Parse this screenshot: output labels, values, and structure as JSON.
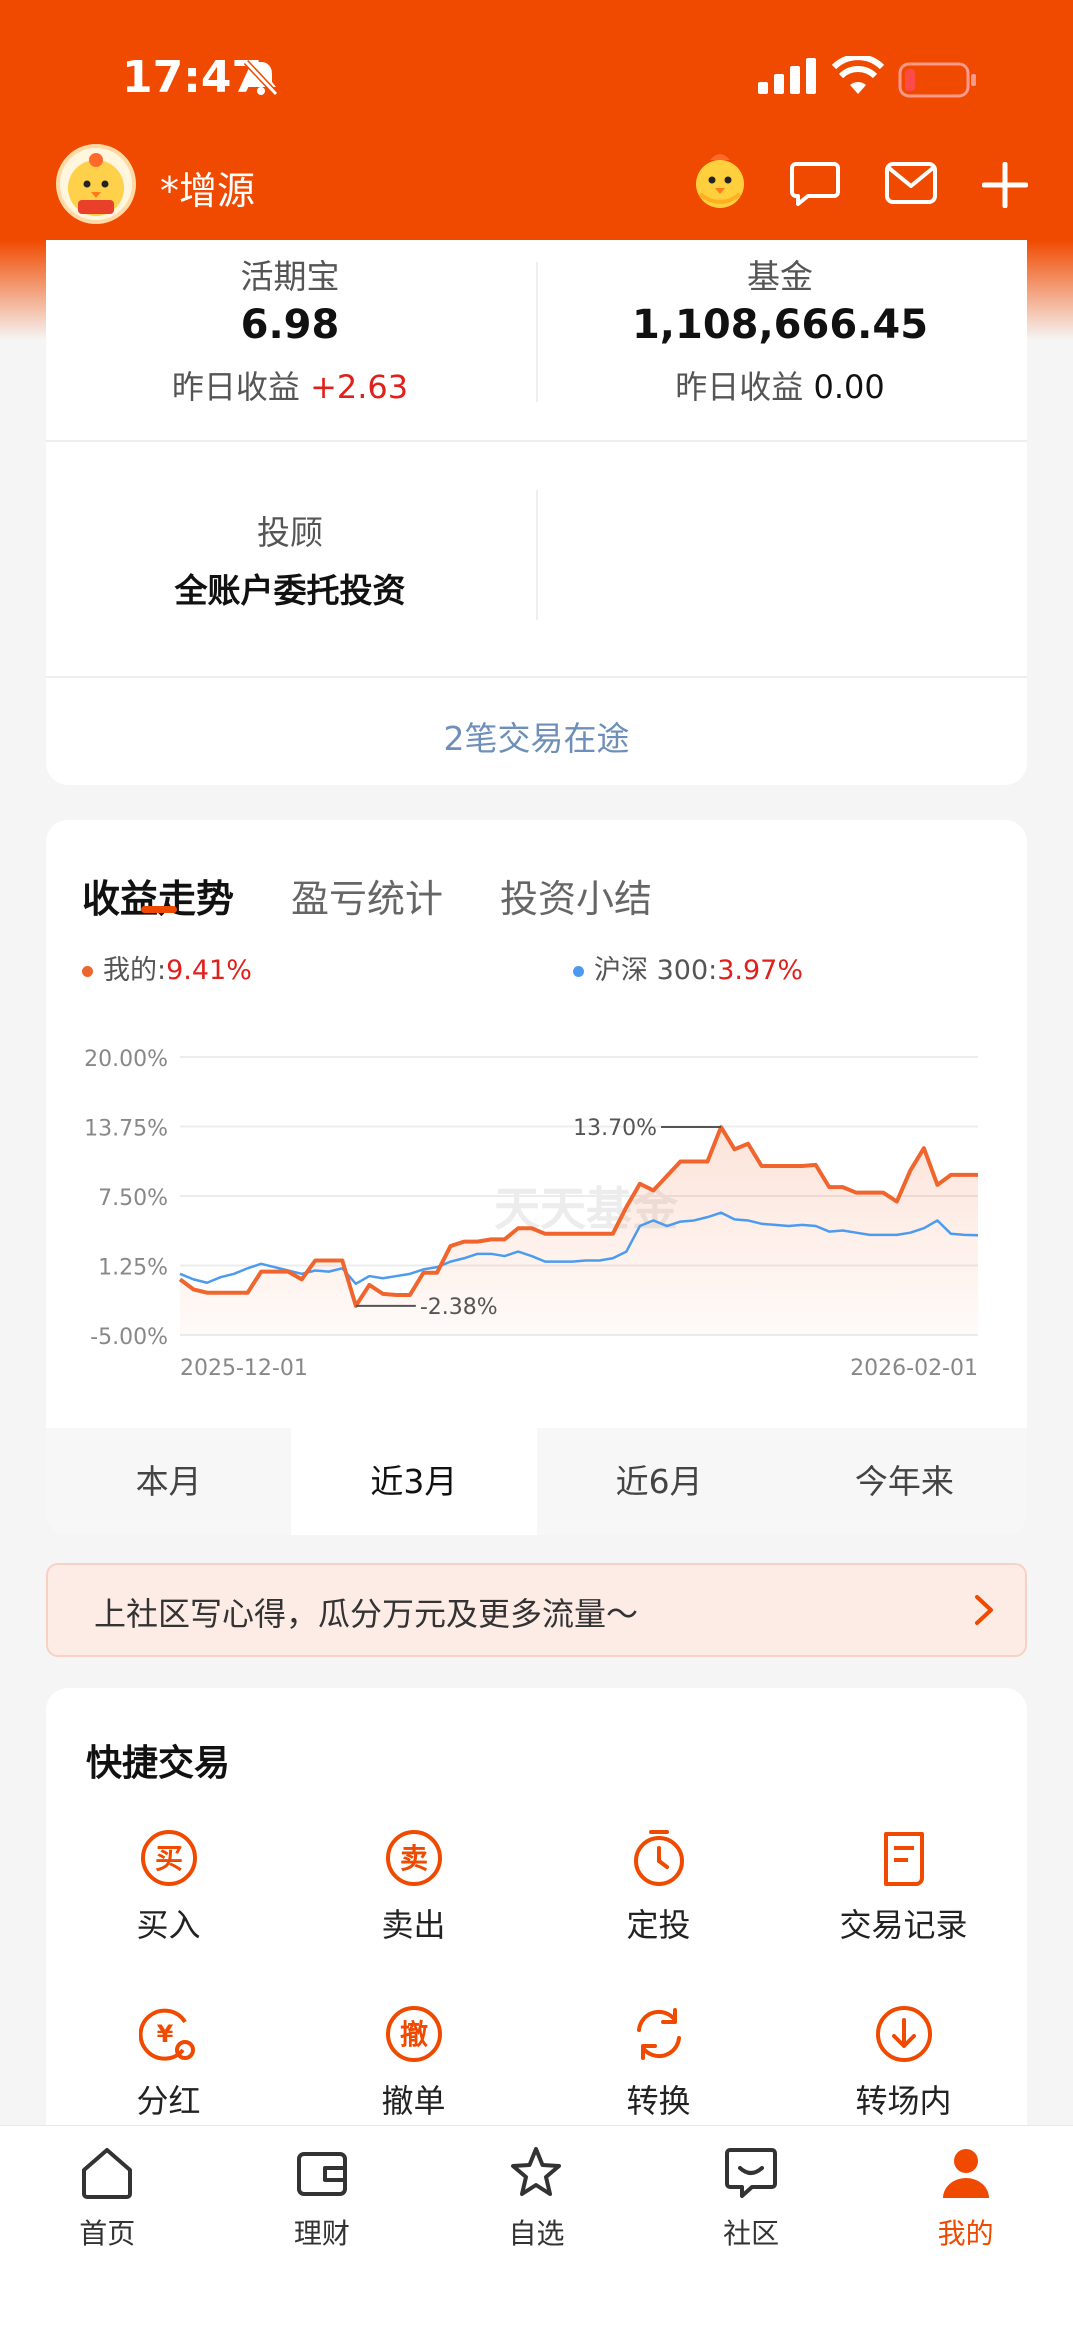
{
  "status": {
    "time": "17:47"
  },
  "header": {
    "username": "*增源",
    "avatar_badge": "招财"
  },
  "accounts": {
    "huoqibao": {
      "label": "活期宝",
      "value": "6.98",
      "yesterday_label": "昨日收益",
      "yesterday_value": "+2.63"
    },
    "fund": {
      "label": "基金",
      "value": "1,108,666.45",
      "yesterday_label": "昨日收益",
      "yesterday_value": "0.00"
    },
    "advisor": {
      "label": "投顾",
      "value": "全账户委托投资"
    },
    "transit": "2笔交易在途"
  },
  "tabs": [
    "收益走势",
    "盈亏统计",
    "投资小结"
  ],
  "legend": {
    "mine_label": "我的:",
    "mine_value": "9.41%",
    "index_label": "沪深 300:",
    "index_value": "3.97%"
  },
  "watermark": "天天基金",
  "ranges": [
    "本月",
    "近3月",
    "近6月",
    "今年来"
  ],
  "banner": {
    "text": "上社区写心得，瓜分万元及更多流量～"
  },
  "quick": {
    "title": "快捷交易",
    "items": [
      "买入",
      "卖出",
      "定投",
      "交易记录",
      "分红",
      "撤单",
      "转换",
      "转场内"
    ],
    "buy_glyph": "买",
    "sell_glyph": "卖",
    "cancel_glyph": "撤",
    "dividend_glyph": "¥"
  },
  "nav": [
    "首页",
    "理财",
    "自选",
    "社区",
    "我的"
  ],
  "colors": {
    "brand": "#f04a00",
    "mine_series": "#f0652d",
    "index_series": "#4d9bef",
    "gain": "#e0201c"
  },
  "chart_data": {
    "type": "line",
    "title": "",
    "xlabel": "",
    "ylabel": "",
    "x_tick_labels": [
      "2025-12-01",
      "2026-02-01"
    ],
    "y_tick_labels": [
      "20.00%",
      "13.75%",
      "7.50%",
      "1.25%",
      "-5.00%"
    ],
    "ylim": [
      -5.0,
      20.0
    ],
    "grid": true,
    "annotations": [
      {
        "label": "13.70%",
        "series": "我的",
        "kind": "max"
      },
      {
        "label": "-2.38%",
        "series": "我的",
        "kind": "min"
      }
    ],
    "series": [
      {
        "name": "我的",
        "values": [
          0.0,
          -0.9,
          -1.2,
          -1.2,
          -1.2,
          -1.2,
          0.7,
          0.7,
          0.7,
          0.0,
          1.7,
          1.7,
          1.7,
          -2.38,
          -0.5,
          -1.3,
          -1.4,
          -1.4,
          0.6,
          0.6,
          3.0,
          3.4,
          3.4,
          3.6,
          3.6,
          4.6,
          4.6,
          4.1,
          4.1,
          4.1,
          4.1,
          4.1,
          4.1,
          6.5,
          8.6,
          8.0,
          9.3,
          10.6,
          10.6,
          10.6,
          13.7,
          11.7,
          12.2,
          10.2,
          10.2,
          10.2,
          10.2,
          10.3,
          8.3,
          8.3,
          7.8,
          7.8,
          7.8,
          7.0,
          9.8,
          11.8,
          8.5,
          9.4,
          9.4,
          9.4
        ],
        "color": "#f0652d"
      },
      {
        "name": "沪深 300",
        "values": [
          0.5,
          0.0,
          -0.3,
          0.2,
          0.5,
          1.0,
          1.4,
          1.1,
          0.8,
          0.5,
          0.8,
          0.7,
          1.0,
          -0.4,
          0.3,
          0.1,
          0.3,
          0.5,
          0.9,
          1.1,
          1.6,
          1.9,
          2.3,
          2.3,
          2.1,
          2.5,
          2.1,
          1.6,
          1.6,
          1.6,
          1.7,
          1.7,
          1.9,
          2.5,
          4.8,
          5.3,
          4.8,
          5.2,
          5.3,
          5.6,
          6.0,
          5.4,
          5.3,
          5.0,
          4.9,
          4.8,
          4.9,
          4.8,
          4.3,
          4.4,
          4.2,
          4.0,
          4.0,
          4.0,
          4.2,
          4.6,
          5.3,
          4.1,
          4.0,
          3.97
        ],
        "color": "#4d9bef"
      }
    ]
  }
}
